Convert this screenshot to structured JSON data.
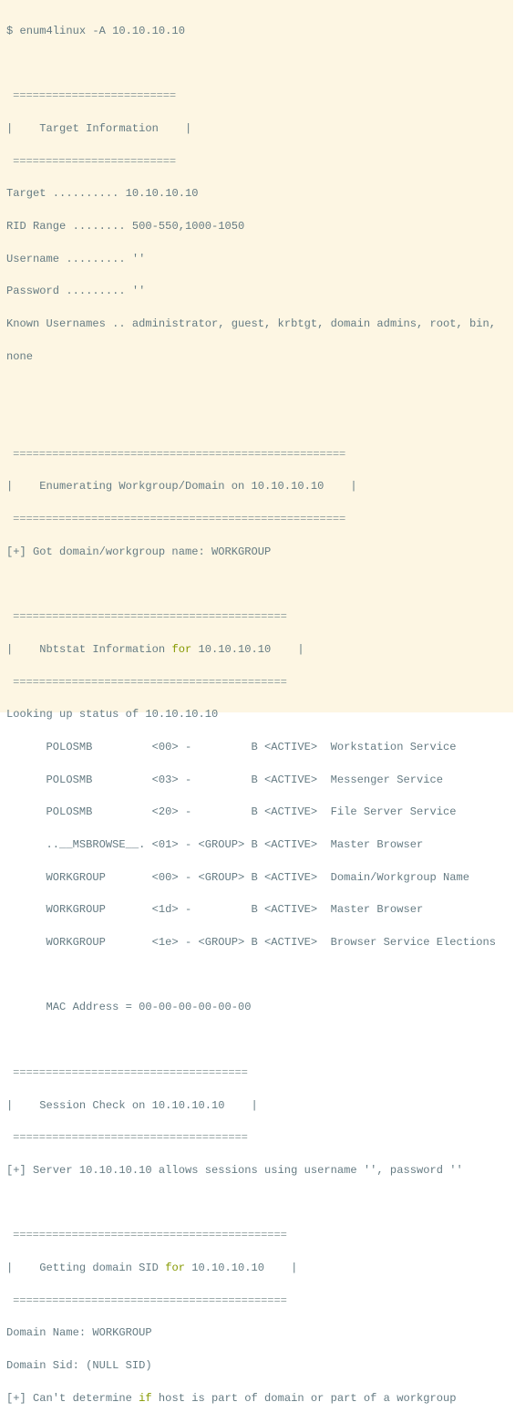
{
  "command": "$ enum4linux -A 10.10.10.10",
  "sections": {
    "target_info": {
      "rule": " =========================",
      "title_pre": "|    Target Information    |",
      "fields": [
        {
          "label": "Target ..........",
          "value": " 10.10.10.10"
        },
        {
          "label": "RID Range ........",
          "value": " 500-550,1000-1050"
        },
        {
          "label": "Username .........",
          "value": " ''"
        },
        {
          "label": "Password .........",
          "value": " ''"
        },
        {
          "label": "Known Usernames ..",
          "value": " administrator, guest, krbtgt, domain admins, root, bin,"
        }
      ],
      "wrap": "none"
    },
    "workgroup": {
      "rule": " ===================================================",
      "title_pre": "|    Enumerating Workgroup/Domain on 10.10.10.10    |",
      "result": "[+] Got domain/workgroup name: WORKGROUP"
    },
    "nbtstat": {
      "rule": " ==========================================",
      "title_a": "|    Nbtstat Information ",
      "title_kw": "for",
      "title_b": " 10.10.10.10    |",
      "lookup": "Looking up status of 10.10.10.10",
      "rows": [
        "      POLOSMB         <00> -         B <ACTIVE>  Workstation Service",
        "      POLOSMB         <03> -         B <ACTIVE>  Messenger Service",
        "      POLOSMB         <20> -         B <ACTIVE>  File Server Service",
        "      ..__MSBROWSE__. <01> - <GROUP> B <ACTIVE>  Master Browser",
        "      WORKGROUP       <00> - <GROUP> B <ACTIVE>  Domain/Workgroup Name",
        "      WORKGROUP       <1d> -         B <ACTIVE>  Master Browser",
        "      WORKGROUP       <1e> - <GROUP> B <ACTIVE>  Browser Service Elections"
      ],
      "mac": "      MAC Address = 00-00-00-00-00-00"
    },
    "session": {
      "rule": " ====================================",
      "title_pre": "|    Session Check on 10.10.10.10    |",
      "result": "[+] Server 10.10.10.10 allows sessions using username '', password ''"
    },
    "domain_sid": {
      "rule": " ==========================================",
      "title_a": "|    Getting domain SID ",
      "title_kw": "for",
      "title_b": " 10.10.10.10    |",
      "domain_name": "Domain Name: WORKGROUP",
      "domain_sid": "Domain Sid: (NULL SID)",
      "result_a": "[+] Can't determine ",
      "result_kw": "if",
      "result_b": " host is part of domain or part of a workgroup"
    }
  },
  "colors": {
    "background": "#fdf6e3",
    "text": "#657b83",
    "keyword": "#859900"
  }
}
